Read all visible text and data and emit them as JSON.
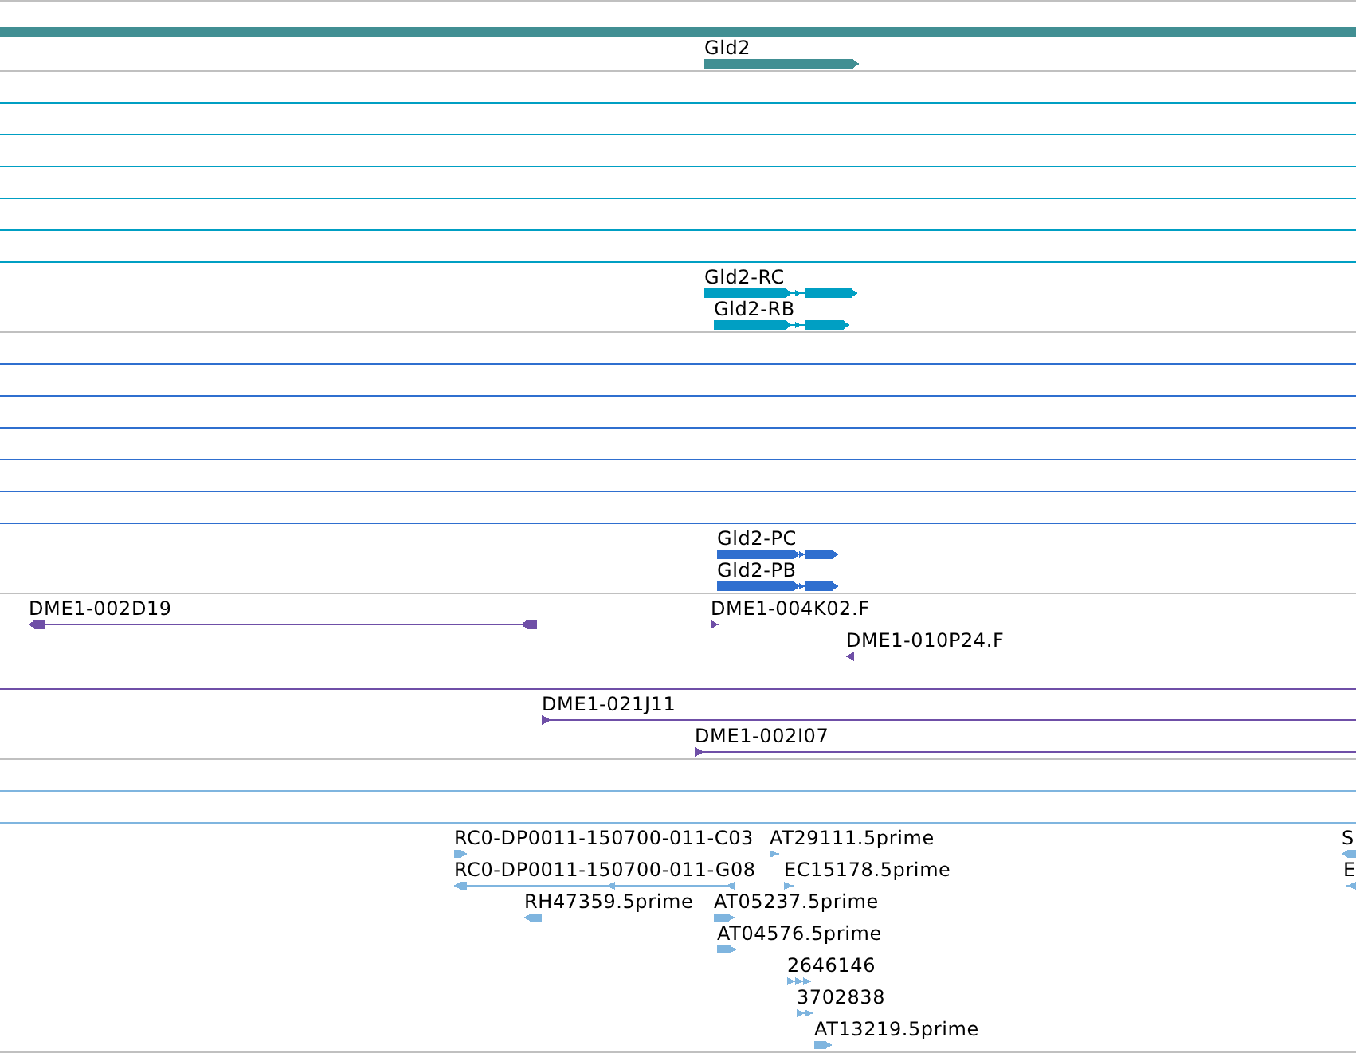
{
  "tracks": [
    {
      "kind": "gene",
      "color": "#418f93",
      "features": [
        {
          "kind": "span"
        },
        {
          "kind": "feature",
          "label": "Gld2",
          "reverse": false
        }
      ]
    },
    {
      "kind": "transcript",
      "color": "#009fc3",
      "features": [
        {
          "kind": "span"
        },
        {
          "kind": "span"
        },
        {
          "kind": "span"
        },
        {
          "kind": "span"
        },
        {
          "kind": "span"
        },
        {
          "kind": "span"
        },
        {
          "kind": "feature",
          "label": "Gld2-RC",
          "reverse": false
        },
        {
          "kind": "feature",
          "label": "Gld2-RB",
          "reverse": false
        }
      ]
    },
    {
      "kind": "protein",
      "color": "#2f6fcf",
      "features": [
        {
          "kind": "span"
        },
        {
          "kind": "span"
        },
        {
          "kind": "span"
        },
        {
          "kind": "span"
        },
        {
          "kind": "span"
        },
        {
          "kind": "span"
        },
        {
          "kind": "feature",
          "label": "Gld2-PC",
          "reverse": false
        },
        {
          "kind": "feature",
          "label": "Gld2-PB",
          "reverse": false
        }
      ]
    },
    {
      "kind": "clone",
      "color": "#6f4fa7",
      "features": [
        {
          "kind": "feature",
          "label": "DME1-002D19",
          "reverse": true
        },
        {
          "kind": "feature",
          "label": "DME1-004K02.F",
          "reverse": false
        },
        {
          "kind": "feature",
          "label": "DME1-010P24.F",
          "reverse": true
        },
        {
          "kind": "span"
        },
        {
          "kind": "feature",
          "label": "DME1-021J11",
          "reverse": false
        },
        {
          "kind": "feature",
          "label": "DME1-002I07",
          "reverse": false
        }
      ]
    },
    {
      "kind": "est",
      "color": "#7fb5df",
      "features": [
        {
          "kind": "span"
        },
        {
          "kind": "span"
        },
        {
          "kind": "feature",
          "label": "RC0-DP0011-150700-011-C03",
          "reverse": false
        },
        {
          "kind": "feature",
          "label": "AT29111.5prime",
          "reverse": false
        },
        {
          "kind": "feature",
          "label": "S",
          "reverse": true
        },
        {
          "kind": "feature",
          "label": "RC0-DP0011-150700-011-G08",
          "reverse": true
        },
        {
          "kind": "feature",
          "label": "EC15178.5prime",
          "reverse": false
        },
        {
          "kind": "feature",
          "label": "E",
          "reverse": true
        },
        {
          "kind": "feature",
          "label": "RH47359.5prime",
          "reverse": true
        },
        {
          "kind": "feature",
          "label": "AT05237.5prime",
          "reverse": false
        },
        {
          "kind": "feature",
          "label": "AT04576.5prime",
          "reverse": false
        },
        {
          "kind": "feature",
          "label": "2646146",
          "reverse": false
        },
        {
          "kind": "feature",
          "label": "3702838",
          "reverse": false
        },
        {
          "kind": "feature",
          "label": "AT13219.5prime",
          "reverse": false
        }
      ]
    }
  ]
}
